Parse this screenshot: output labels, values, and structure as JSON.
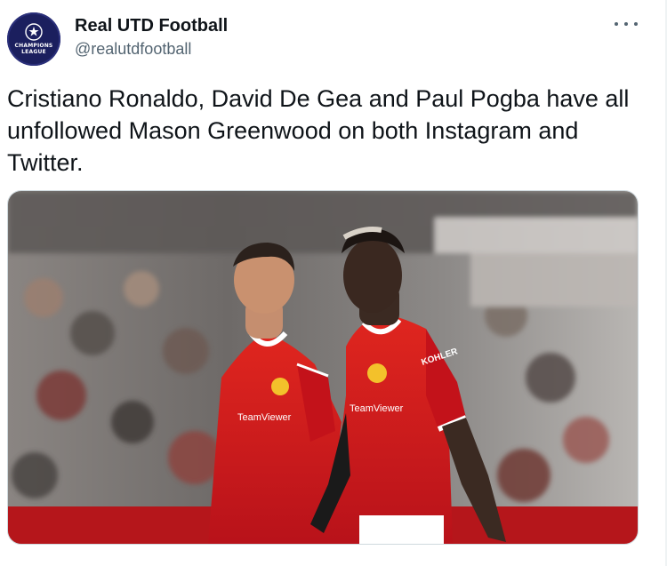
{
  "tweet": {
    "author": {
      "display_name": "Real UTD Football",
      "handle": "@realutdfootball",
      "avatar_logo_text": "CHAMPIONS LEAGUE"
    },
    "text": "Cristiano Ronaldo, David De Gea and Paul Pogba have all unfollowed Mason Greenwood on both Instagram and Twitter.",
    "more_icon": "ellipsis-icon",
    "media": {
      "kit_sponsor_text": "TeamViewer",
      "sleeve_text": "KOHLER"
    }
  },
  "colors": {
    "text_primary": "#0f1419",
    "text_secondary": "#536471",
    "kit_red": "#d2171c",
    "avatar_bg": "#1b1f5e"
  }
}
